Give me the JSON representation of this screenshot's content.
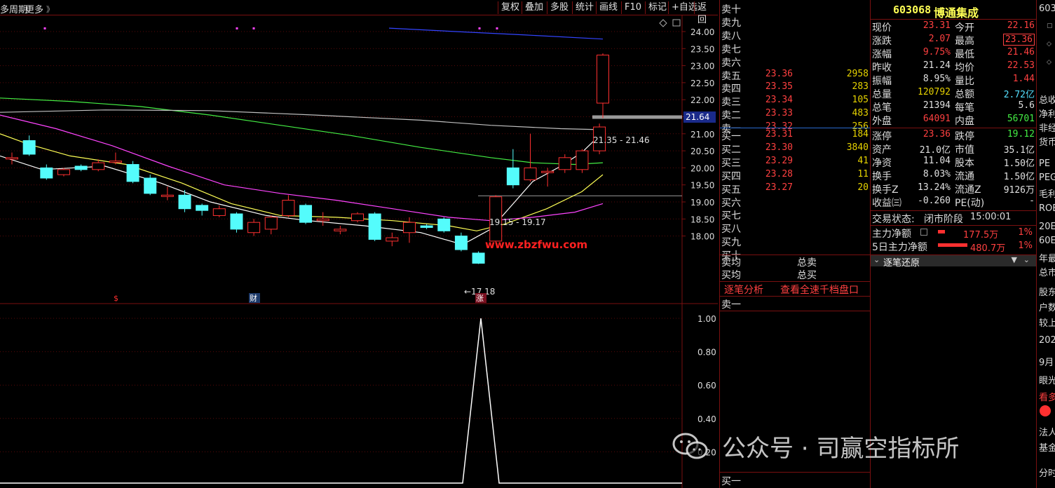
{
  "toolbar": {
    "period": "多周期",
    "more": "更多",
    "buttons": [
      "复权",
      "叠加",
      "多股",
      "统计",
      "画线",
      "F10",
      "标记",
      "+自选",
      "返回"
    ]
  },
  "chart": {
    "price_axis": [
      "24.00",
      "23.50",
      "23.00",
      "22.50",
      "22.00",
      "21.50",
      "21.00",
      "20.50",
      "20.00",
      "19.50",
      "19.00",
      "18.50",
      "18.00"
    ],
    "current_tag": "21.64",
    "range_top": "21.35 - 21.46",
    "range_mid": "19.15 - 19.17",
    "low_label": "←17.18",
    "site_text": "www.zbzfwu.com",
    "event_s": "$",
    "event_cai": "财",
    "event_zhang": "涨",
    "indicator_axis": [
      "1.00",
      "0.80",
      "0.60",
      "0.40",
      "0.20"
    ],
    "colors": {
      "up": "#ff3030",
      "down": "#54fcfc",
      "ma5": "#ffffff",
      "ma10": "#ffff55",
      "ma20": "#ff44ff",
      "ma60": "#44ee44",
      "ma120": "#c0c0c0",
      "ma250": "#3344ff"
    }
  },
  "quote": {
    "sells": [
      {
        "label": "卖十",
        "price": "",
        "vol": ""
      },
      {
        "label": "卖九",
        "price": "",
        "vol": ""
      },
      {
        "label": "卖八",
        "price": "",
        "vol": ""
      },
      {
        "label": "卖七",
        "price": "",
        "vol": ""
      },
      {
        "label": "卖六",
        "price": "",
        "vol": ""
      },
      {
        "label": "卖五",
        "price": "23.36",
        "vol": "2958"
      },
      {
        "label": "卖四",
        "price": "23.35",
        "vol": "283"
      },
      {
        "label": "卖三",
        "price": "23.34",
        "vol": "105"
      },
      {
        "label": "卖二",
        "price": "23.33",
        "vol": "483"
      },
      {
        "label": "卖一",
        "price": "23.32",
        "vol": "256"
      }
    ],
    "buys": [
      {
        "label": "买一",
        "price": "23.31",
        "vol": "184"
      },
      {
        "label": "买二",
        "price": "23.30",
        "vol": "3840"
      },
      {
        "label": "买三",
        "price": "23.29",
        "vol": "41"
      },
      {
        "label": "买四",
        "price": "23.28",
        "vol": "11"
      },
      {
        "label": "买五",
        "price": "23.27",
        "vol": "20"
      },
      {
        "label": "买六",
        "price": "",
        "vol": ""
      },
      {
        "label": "买七",
        "price": "",
        "vol": ""
      },
      {
        "label": "买八",
        "price": "",
        "vol": ""
      },
      {
        "label": "买九",
        "price": "",
        "vol": ""
      },
      {
        "label": "买十",
        "price": "",
        "vol": ""
      }
    ],
    "avg_sell": "卖均",
    "avg_buy": "买均",
    "total_sell": "总卖",
    "total_buy": "总买",
    "tick_analysis": "逐笔分析",
    "full_depth": "查看全速千档盘口",
    "sell1_label": "卖一",
    "buy1_label": "买一"
  },
  "detail": {
    "code": "603068",
    "name": "博通集成",
    "rows": [
      {
        "l1": "现价",
        "v1": "23.31",
        "c1": "#ff4040",
        "l2": "今开",
        "v2": "22.16",
        "c2": "#ff4040"
      },
      {
        "l1": "涨跌",
        "v1": "2.07",
        "c1": "#ff4040",
        "l2": "最高",
        "v2": "23.36",
        "c2": "#ff4040"
      },
      {
        "l1": "涨幅",
        "v1": "9.75%",
        "c1": "#ff4040",
        "l2": "最低",
        "v2": "21.46",
        "c2": "#ff4040"
      },
      {
        "l1": "昨收",
        "v1": "21.24",
        "c1": "#e0e0e0",
        "l2": "均价",
        "v2": "22.53",
        "c2": "#ff4040"
      },
      {
        "l1": "振幅",
        "v1": "8.95%",
        "c1": "#e0e0e0",
        "l2": "量比",
        "v2": "1.44",
        "c2": "#ff4040"
      },
      {
        "l1": "总量",
        "v1": "120792",
        "c1": "#e6d200",
        "l2": "总额",
        "v2": "2.72亿",
        "c2": "#55e0ff"
      },
      {
        "l1": "总笔",
        "v1": "21394",
        "c1": "#e0e0e0",
        "l2": "每笔",
        "v2": "5.6",
        "c2": "#e0e0e0"
      },
      {
        "l1": "外盘",
        "v1": "64091",
        "c1": "#ff4040",
        "l2": "内盘",
        "v2": "56701",
        "c2": "#44ee44"
      },
      {
        "l1": "涨停",
        "v1": "23.36",
        "c1": "#ff4040",
        "l2": "跌停",
        "v2": "19.12",
        "c2": "#44ee44"
      },
      {
        "l1": "资产",
        "v1": "21.0亿",
        "c1": "#e0e0e0",
        "l2": "市值",
        "v2": "35.1亿",
        "c2": "#e0e0e0"
      },
      {
        "l1": "净资",
        "v1": "11.04",
        "c1": "#e0e0e0",
        "l2": "股本",
        "v2": "1.50亿",
        "c2": "#e0e0e0"
      },
      {
        "l1": "换手",
        "v1": "8.03%",
        "c1": "#e0e0e0",
        "l2": "流通",
        "v2": "1.50亿",
        "c2": "#e0e0e0"
      },
      {
        "l1": "换手Z",
        "v1": "13.24%",
        "c1": "#e0e0e0",
        "l2": "流通Z",
        "v2": "9126万",
        "c2": "#e0e0e0"
      },
      {
        "l1": "收益㈢",
        "v1": "-0.260",
        "c1": "#e0e0e0",
        "l2": "PE(动)",
        "v2": "-",
        "c2": "#e0e0e0"
      }
    ],
    "trade_status_label": "交易状态:",
    "trade_status": "闭市阶段",
    "trade_time": "15:00:01",
    "main_net_label": "主力净额",
    "main_net_value": "177.5万",
    "main_net_pct": "1%",
    "main5_label": "5日主力净额",
    "main5_value": "480.7万",
    "main5_pct": "1%",
    "replay_label": "逐笔还原"
  },
  "edge": [
    "603",
    "总收",
    "净利",
    "非经",
    "货币",
    "PE",
    "PEG",
    "毛利",
    "ROE",
    "20E",
    "60E",
    "年最",
    "总市",
    "股东",
    "户数",
    "较上",
    "202",
    "9月",
    "眼光",
    "看多",
    "法人",
    "基金",
    "分时"
  ],
  "watermark": "公众号 · 司赢空指标所"
}
